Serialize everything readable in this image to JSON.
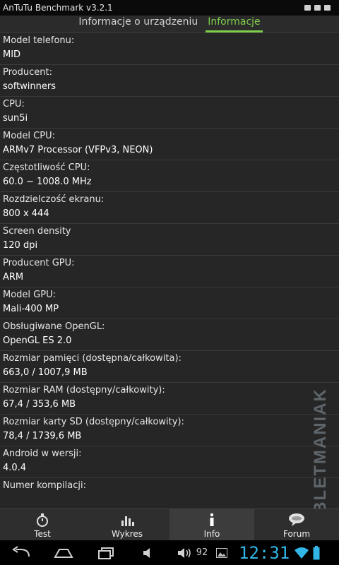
{
  "app": {
    "title": "AnTuTu Benchmark v3.2.1"
  },
  "tabs": [
    {
      "label": "Informacje o urządzeniu",
      "active": false
    },
    {
      "label": "Informacje",
      "active": true
    }
  ],
  "info": [
    {
      "label": "Model telefonu:",
      "value": "MID"
    },
    {
      "label": "Producent:",
      "value": "softwinners"
    },
    {
      "label": "CPU:",
      "value": "sun5i"
    },
    {
      "label": "Model CPU:",
      "value": "ARMv7 Processor (VFPv3, NEON)"
    },
    {
      "label": "Częstotliwość CPU:",
      "value": "60.0 ~ 1008.0 MHz"
    },
    {
      "label": "Rozdzielczość ekranu:",
      "value": "800 x 444"
    },
    {
      "label": "Screen density",
      "value": "120 dpi"
    },
    {
      "label": "Producent GPU:",
      "value": "ARM"
    },
    {
      "label": "Model GPU:",
      "value": "Mali-400 MP"
    },
    {
      "label": "Obsługiwane OpenGL:",
      "value": "OpenGL ES 2.0"
    },
    {
      "label": "Rozmiar pamięci (dostępna/całkowita):",
      "value": "663,0 / 1007,9 MB"
    },
    {
      "label": "Rozmiar RAM (dostępny/całkowity):",
      "value": "67,4 / 353,6 MB"
    },
    {
      "label": "Rozmiar karty SD (dostępny/całkowity):",
      "value": "78,4 / 1739,6 MB"
    },
    {
      "label": "Android w wersji:",
      "value": "4.0.4"
    },
    {
      "label": "Numer kompilacji:",
      "value": ""
    }
  ],
  "nav": [
    {
      "label": "Test",
      "icon": "stopwatch-icon"
    },
    {
      "label": "Wykres",
      "icon": "bar-chart-icon"
    },
    {
      "label": "Info",
      "icon": "info-icon",
      "active": true
    },
    {
      "label": "Forum",
      "icon": "chat-bubble-icon"
    }
  ],
  "watermark": "TABLETMANIAK",
  "status": {
    "volume": "92",
    "time": "12:31"
  },
  "colors": {
    "accent": "#7fce4a",
    "clock": "#31b6e7"
  }
}
